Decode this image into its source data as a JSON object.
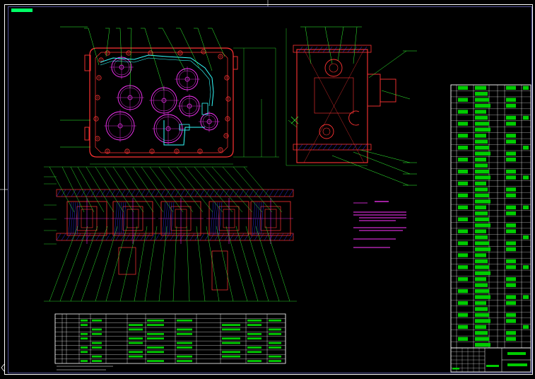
{
  "colors": {
    "background": "#000000",
    "frame": "#ffffff",
    "outline": "#ff3333",
    "leader": "#33ff33",
    "gear": "#ff33ff",
    "shaft": "#33ffff",
    "hatch": "#3333ff",
    "note_text": "#ff33ff",
    "table_line": "#ffffff",
    "table_fill": "#00cc00",
    "title_tag": "#00ff66"
  },
  "icons": {
    "corner_left_marker": "chevron-left-icon",
    "crosshair_marker": "crosshair-icon"
  },
  "sections": {
    "front_view": "gearbox-front-view",
    "side_view": "gearbox-side-view",
    "section_views": "shaft-section-views",
    "tech_notes": "technical-requirements",
    "parts_list": "bill-of-materials",
    "title_block": "title-block",
    "param_table": "gear-parameter-table"
  },
  "counts": {
    "parts_list_rows": 44,
    "param_table_rows": 11,
    "param_table_cols": 13,
    "front_view_gears": 8,
    "section_view_count": 5,
    "tech_note_items": 4
  }
}
